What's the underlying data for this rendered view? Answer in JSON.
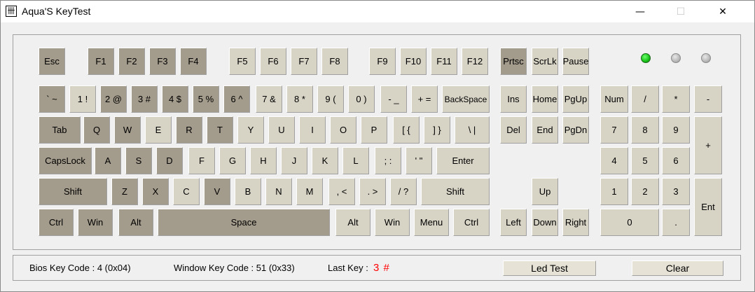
{
  "window": {
    "title": "Aqua'S KeyTest",
    "app_icon_glyph": "卌",
    "controls": {
      "minimize": "—",
      "maximize": "☐",
      "close": "✕"
    }
  },
  "keys": {
    "row_fn": [
      {
        "id": "esc",
        "label": "Esc",
        "pressed": true
      },
      {
        "id": "f1",
        "label": "F1",
        "pressed": true
      },
      {
        "id": "f2",
        "label": "F2",
        "pressed": true
      },
      {
        "id": "f3",
        "label": "F3",
        "pressed": true
      },
      {
        "id": "f4",
        "label": "F4",
        "pressed": true
      },
      {
        "id": "f5",
        "label": "F5",
        "pressed": false
      },
      {
        "id": "f6",
        "label": "F6",
        "pressed": false
      },
      {
        "id": "f7",
        "label": "F7",
        "pressed": false
      },
      {
        "id": "f8",
        "label": "F8",
        "pressed": false
      },
      {
        "id": "f9",
        "label": "F9",
        "pressed": false
      },
      {
        "id": "f10",
        "label": "F10",
        "pressed": false
      },
      {
        "id": "f11",
        "label": "F11",
        "pressed": false
      },
      {
        "id": "f12",
        "label": "F12",
        "pressed": false
      },
      {
        "id": "prtsc",
        "label": "Prtsc",
        "pressed": true
      },
      {
        "id": "scrlk",
        "label": "ScrLk",
        "pressed": false
      },
      {
        "id": "pause",
        "label": "Pause",
        "pressed": false
      }
    ],
    "row_num": [
      {
        "id": "backtick",
        "label": "` ~",
        "pressed": true
      },
      {
        "id": "1",
        "label": "1 !",
        "pressed": false
      },
      {
        "id": "2",
        "label": "2 @",
        "pressed": true
      },
      {
        "id": "3",
        "label": "3 #",
        "pressed": true
      },
      {
        "id": "4",
        "label": "4 $",
        "pressed": true
      },
      {
        "id": "5",
        "label": "5 %",
        "pressed": true
      },
      {
        "id": "6",
        "label": "6 ^",
        "pressed": true
      },
      {
        "id": "7",
        "label": "7 &",
        "pressed": false
      },
      {
        "id": "8",
        "label": "8 *",
        "pressed": false
      },
      {
        "id": "9",
        "label": "9 (",
        "pressed": false
      },
      {
        "id": "0",
        "label": "0 )",
        "pressed": false
      },
      {
        "id": "minus",
        "label": "- _",
        "pressed": false
      },
      {
        "id": "equals",
        "label": "+ =",
        "pressed": false
      },
      {
        "id": "backspace",
        "label": "BackSpace",
        "pressed": false
      }
    ],
    "row_tab": [
      {
        "id": "tab",
        "label": "Tab",
        "pressed": true
      },
      {
        "id": "q",
        "label": "Q",
        "pressed": true
      },
      {
        "id": "w",
        "label": "W",
        "pressed": true
      },
      {
        "id": "e",
        "label": "E",
        "pressed": false
      },
      {
        "id": "r",
        "label": "R",
        "pressed": true
      },
      {
        "id": "t",
        "label": "T",
        "pressed": true
      },
      {
        "id": "y",
        "label": "Y",
        "pressed": false
      },
      {
        "id": "u",
        "label": "U",
        "pressed": false
      },
      {
        "id": "i",
        "label": "I",
        "pressed": false
      },
      {
        "id": "o",
        "label": "O",
        "pressed": false
      },
      {
        "id": "p",
        "label": "P",
        "pressed": false
      },
      {
        "id": "lbracket",
        "label": "[ {",
        "pressed": false
      },
      {
        "id": "rbracket",
        "label": "] }",
        "pressed": false
      },
      {
        "id": "backslash",
        "label": "\\ |",
        "pressed": false
      }
    ],
    "row_caps": [
      {
        "id": "capslock",
        "label": "CapsLock",
        "pressed": true
      },
      {
        "id": "a",
        "label": "A",
        "pressed": true
      },
      {
        "id": "s",
        "label": "S",
        "pressed": true
      },
      {
        "id": "d",
        "label": "D",
        "pressed": true
      },
      {
        "id": "f",
        "label": "F",
        "pressed": false
      },
      {
        "id": "g",
        "label": "G",
        "pressed": false
      },
      {
        "id": "h",
        "label": "H",
        "pressed": false
      },
      {
        "id": "j",
        "label": "J",
        "pressed": false
      },
      {
        "id": "k",
        "label": "K",
        "pressed": false
      },
      {
        "id": "l",
        "label": "L",
        "pressed": false
      },
      {
        "id": "semicolon",
        "label": "; :",
        "pressed": false
      },
      {
        "id": "quote",
        "label": "' \"",
        "pressed": false
      },
      {
        "id": "enter",
        "label": "Enter",
        "pressed": false
      }
    ],
    "row_shift": [
      {
        "id": "lshift",
        "label": "Shift",
        "pressed": true
      },
      {
        "id": "z",
        "label": "Z",
        "pressed": true
      },
      {
        "id": "x",
        "label": "X",
        "pressed": true
      },
      {
        "id": "c",
        "label": "C",
        "pressed": false
      },
      {
        "id": "v",
        "label": "V",
        "pressed": true
      },
      {
        "id": "b",
        "label": "B",
        "pressed": false
      },
      {
        "id": "n",
        "label": "N",
        "pressed": false
      },
      {
        "id": "m",
        "label": "M",
        "pressed": false
      },
      {
        "id": "comma",
        "label": ", <",
        "pressed": false
      },
      {
        "id": "period",
        "label": ". >",
        "pressed": false
      },
      {
        "id": "slash",
        "label": "/ ?",
        "pressed": false
      },
      {
        "id": "rshift",
        "label": "Shift",
        "pressed": false
      }
    ],
    "row_ctrl": [
      {
        "id": "lctrl",
        "label": "Ctrl",
        "pressed": true
      },
      {
        "id": "lwin",
        "label": "Win",
        "pressed": true
      },
      {
        "id": "lalt",
        "label": "Alt",
        "pressed": true
      },
      {
        "id": "space",
        "label": "Space",
        "pressed": true
      },
      {
        "id": "ralt",
        "label": "Alt",
        "pressed": false
      },
      {
        "id": "rwin",
        "label": "Win",
        "pressed": false
      },
      {
        "id": "menu",
        "label": "Menu",
        "pressed": false
      },
      {
        "id": "rctrl",
        "label": "Ctrl",
        "pressed": false
      }
    ],
    "nav": [
      {
        "id": "ins",
        "label": "Ins",
        "pressed": false
      },
      {
        "id": "home",
        "label": "Home",
        "pressed": false
      },
      {
        "id": "pgup",
        "label": "PgUp",
        "pressed": false
      },
      {
        "id": "del",
        "label": "Del",
        "pressed": false
      },
      {
        "id": "end",
        "label": "End",
        "pressed": false
      },
      {
        "id": "pgdn",
        "label": "PgDn",
        "pressed": false
      },
      {
        "id": "up",
        "label": "Up",
        "pressed": false
      },
      {
        "id": "left",
        "label": "Left",
        "pressed": false
      },
      {
        "id": "down",
        "label": "Down",
        "pressed": false
      },
      {
        "id": "right",
        "label": "Right",
        "pressed": false
      }
    ],
    "numpad": [
      {
        "id": "numlock",
        "label": "Num",
        "pressed": false
      },
      {
        "id": "kp_div",
        "label": "/",
        "pressed": false
      },
      {
        "id": "kp_mul",
        "label": "*",
        "pressed": false
      },
      {
        "id": "kp_sub",
        "label": "-",
        "pressed": false
      },
      {
        "id": "kp7",
        "label": "7",
        "pressed": false
      },
      {
        "id": "kp8",
        "label": "8",
        "pressed": false
      },
      {
        "id": "kp9",
        "label": "9",
        "pressed": false
      },
      {
        "id": "kp_add",
        "label": "+",
        "pressed": false
      },
      {
        "id": "kp4",
        "label": "4",
        "pressed": false
      },
      {
        "id": "kp5",
        "label": "5",
        "pressed": false
      },
      {
        "id": "kp6",
        "label": "6",
        "pressed": false
      },
      {
        "id": "kp1",
        "label": "1",
        "pressed": false
      },
      {
        "id": "kp2",
        "label": "2",
        "pressed": false
      },
      {
        "id": "kp3",
        "label": "3",
        "pressed": false
      },
      {
        "id": "kp_enter",
        "label": "Ent",
        "pressed": false
      },
      {
        "id": "kp0",
        "label": "0",
        "pressed": false
      },
      {
        "id": "kp_dot",
        "label": ".",
        "pressed": false
      }
    ]
  },
  "leds": [
    {
      "id": "led-1",
      "state": "on"
    },
    {
      "id": "led-2",
      "state": "off"
    },
    {
      "id": "led-3",
      "state": "off"
    }
  ],
  "colors": {
    "key_pressed": "#a39b8b",
    "key_normal": "#d7d4c6",
    "led_on": "#16c016",
    "last_key_text": "#ff0000"
  },
  "status": {
    "bios_key_code": "Bios Key Code : 4 (0x04)",
    "window_key_code": "Window Key Code : 51 (0x33)",
    "last_key_label": "Last Key :",
    "last_key_value": "3 #",
    "led_test_button": "Led Test",
    "clear_button": "Clear"
  }
}
